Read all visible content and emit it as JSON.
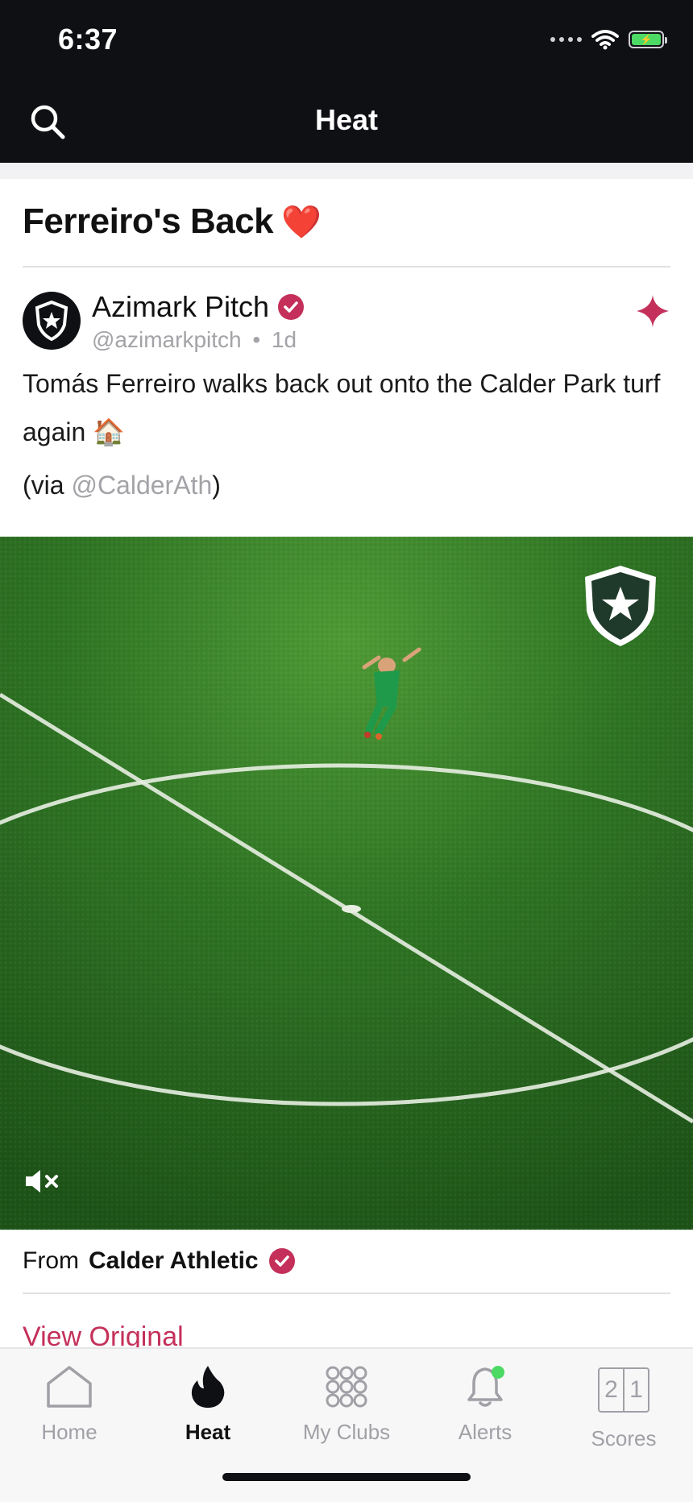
{
  "status_bar": {
    "time": "6:37"
  },
  "nav": {
    "title": "Heat",
    "search_icon": "search-icon"
  },
  "post": {
    "title": "Ferreiro's Back",
    "title_emoji": "❤️",
    "author": {
      "name": "Azimark Pitch",
      "handle": "@azimarkpitch",
      "separator": "•",
      "age": "1d"
    },
    "body": "Tomás Ferreiro walks back out onto the Calder Park turf again 🏠",
    "via_prefix": "(via ",
    "via_handle": "@CalderAth",
    "via_suffix": ")",
    "from_label": "From",
    "from_club": "Calder Athletic",
    "view_original": "View Original"
  },
  "tabs": [
    {
      "label": "Home",
      "icon": "home-icon",
      "active": false
    },
    {
      "label": "Heat",
      "icon": "flame-icon",
      "active": true
    },
    {
      "label": "My Clubs",
      "icon": "clubs-grid-icon",
      "active": false
    },
    {
      "label": "Alerts",
      "icon": "bell-icon",
      "active": false
    },
    {
      "label": "Scores",
      "icon": "scores-icon",
      "score_left": "2",
      "score_right": "1",
      "active": false
    }
  ],
  "colors": {
    "accent": "#c4305a",
    "topbar": "#0f1014",
    "alert_dot": "#4cd964"
  }
}
